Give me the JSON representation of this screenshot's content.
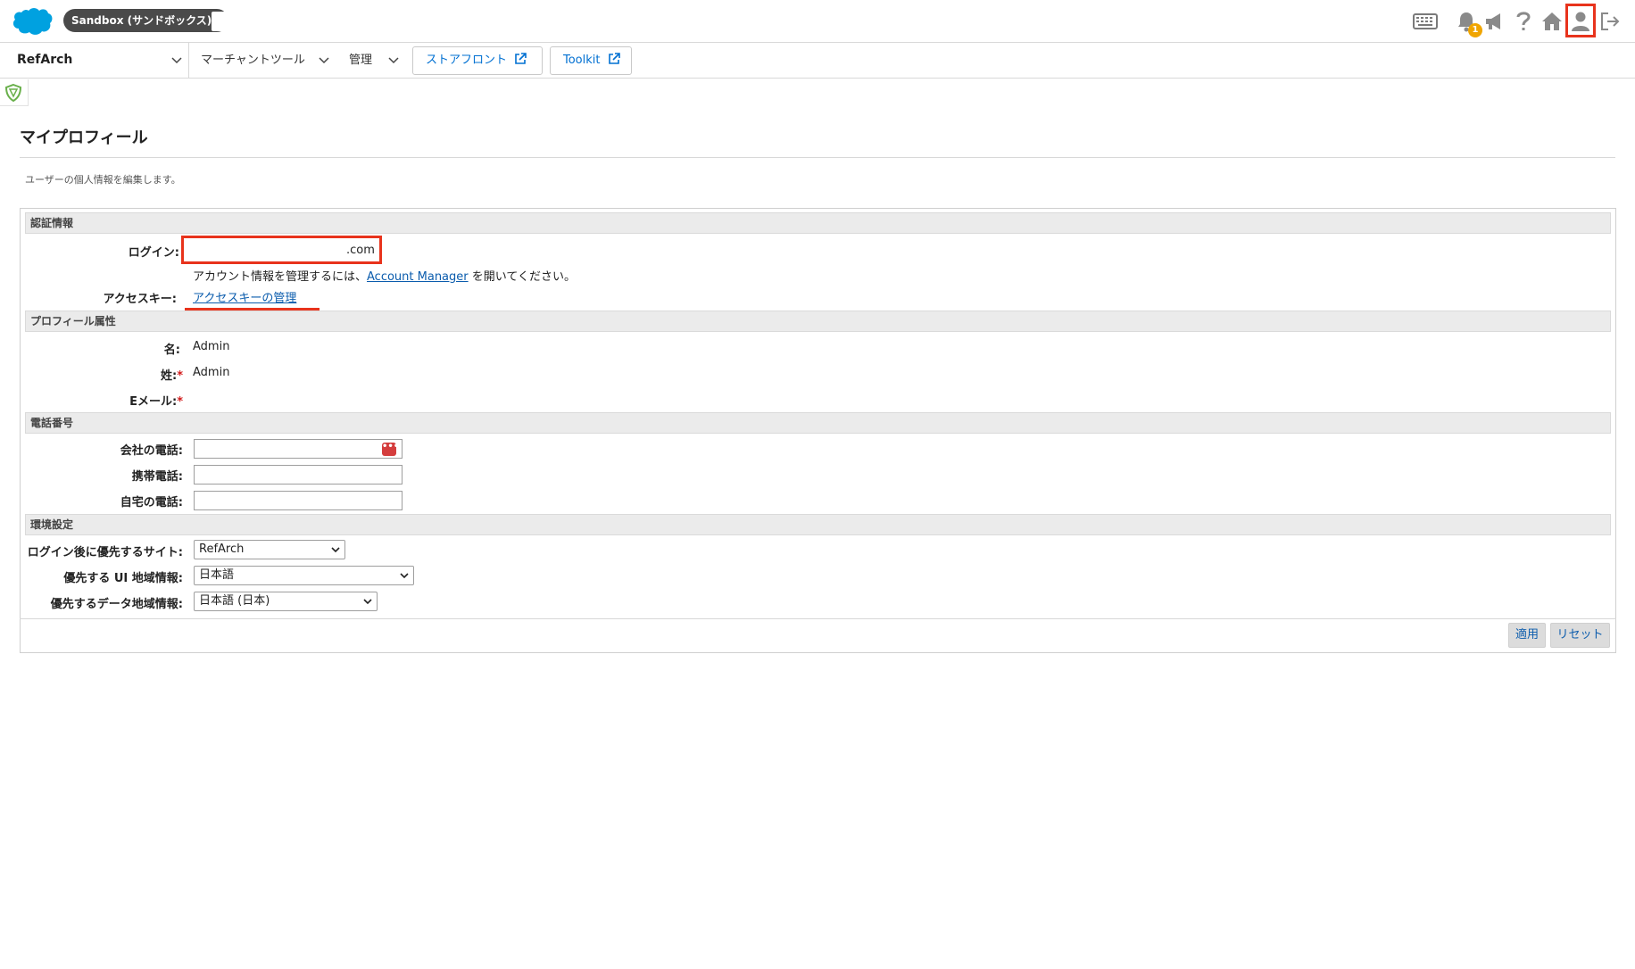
{
  "header": {
    "logo_icon": "salesforce-cloud-logo",
    "environment_label": "Sandbox (サンドボックス) -",
    "notification_count": "1",
    "icons": [
      "keyboard-icon",
      "bell-icon",
      "megaphone-icon",
      "help-icon",
      "home-icon",
      "user-icon",
      "logout-icon"
    ]
  },
  "nav": {
    "site_name": "RefArch",
    "merchant_tools_label": "マーチャントツール",
    "admin_label": "管理",
    "storefront_label": "ストアフロント",
    "toolkit_label": "Toolkit"
  },
  "page": {
    "title": "マイプロフィール",
    "description": "ユーザーの個人情報を編集します。"
  },
  "form": {
    "auth_section": {
      "title": "認証情報",
      "login_label": "ログイン:",
      "login_value_suffix": ".com",
      "account_info_prefix": "アカウント情報を管理するには、",
      "account_manager_link": "Account Manager",
      "account_info_suffix": " を開いてください。",
      "access_key_label": "アクセスキー:",
      "access_key_link": "アクセスキーの管理"
    },
    "profile_section": {
      "title": "プロフィール属性",
      "first_name_label": "名:",
      "first_name_value": "Admin",
      "last_name_label": "姓:",
      "last_name_value": "Admin",
      "email_label": "Eメール:",
      "required_mark": "*"
    },
    "phone_section": {
      "title": "電話番号",
      "business_phone_label": "会社の電話:",
      "business_phone_value": "",
      "mobile_phone_label": "携帯電話:",
      "mobile_phone_value": "",
      "home_phone_label": "自宅の電話:",
      "home_phone_value": ""
    },
    "preferences_section": {
      "title": "環境設定",
      "preferred_site_label": "ログイン後に優先するサイト:",
      "preferred_site_value": "RefArch",
      "ui_locale_label": "優先する UI 地域情報:",
      "ui_locale_value": "日本語",
      "data_locale_label": "優先するデータ地域情報:",
      "data_locale_value": "日本語 (日本)"
    },
    "actions": {
      "apply_label": "適用",
      "reset_label": "リセット"
    }
  },
  "colors": {
    "highlight_red": "#e8331c",
    "link_blue": "#0b5cad",
    "brand_blue": "#00a1e0",
    "badge_orange": "#f0a500"
  }
}
